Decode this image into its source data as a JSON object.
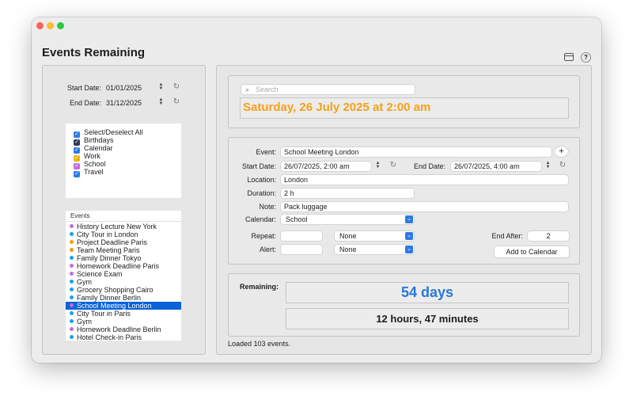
{
  "window": {
    "title": "Events Remaining"
  },
  "dates": {
    "start_label": "Start Date:",
    "start_value": "01/01/2025",
    "end_label": "End Date:",
    "end_value": "31/12/2025"
  },
  "filters": [
    {
      "label": "Select/Deselect All",
      "color": "#2c7be5",
      "checked": true
    },
    {
      "label": "Birthdays",
      "color": "#2d3a5a",
      "checked": true
    },
    {
      "label": "Calendar",
      "color": "#2c7be5",
      "checked": true
    },
    {
      "label": "Work",
      "color": "#e6b800",
      "checked": true
    },
    {
      "label": "School",
      "color": "#c56bd9",
      "checked": true
    },
    {
      "label": "Travel",
      "color": "#2c7be5",
      "checked": true
    }
  ],
  "events": {
    "header": "Events",
    "items": [
      {
        "label": "History Lecture New York",
        "color": "#c56bd9"
      },
      {
        "label": "City Tour in London",
        "color": "#1ea0e6"
      },
      {
        "label": "Project Deadline Paris",
        "color": "#f39c12"
      },
      {
        "label": "Team Meeting Paris",
        "color": "#f39c12"
      },
      {
        "label": "Family Dinner Tokyo",
        "color": "#1ea0e6"
      },
      {
        "label": "Homework Deadline Paris",
        "color": "#c56bd9"
      },
      {
        "label": "Science Exam",
        "color": "#c56bd9"
      },
      {
        "label": "Gym",
        "color": "#1ea0e6"
      },
      {
        "label": "Grocery Shopping Cairo",
        "color": "#1ea0e6"
      },
      {
        "label": "Family Dinner Berlin",
        "color": "#1ea0e6"
      },
      {
        "label": "School Meeting London",
        "color": "#c56bd9",
        "selected": true
      },
      {
        "label": "City Tour in Paris",
        "color": "#1ea0e6"
      },
      {
        "label": "Gym",
        "color": "#1ea0e6"
      },
      {
        "label": "Homework Deadline Berlin",
        "color": "#c56bd9"
      },
      {
        "label": "Hotel Check-in Paris",
        "color": "#1ea0e6"
      }
    ]
  },
  "search": {
    "placeholder": "Search"
  },
  "header_date": "Saturday, 26 July 2025 at 2:00 am",
  "form": {
    "event_label": "Event:",
    "event_value": "School Meeting London",
    "start_label": "Start Date:",
    "start_value": "26/07/2025,   2:00 am",
    "end_label": "End Date:",
    "end_value": "26/07/2025,   4:00 am",
    "location_label": "Location:",
    "location_value": "London",
    "duration_label": "Duration:",
    "duration_value": "2 h",
    "note_label": "Note:",
    "note_value": "Pack luggage",
    "calendar_label": "Calendar:",
    "calendar_value": "School",
    "repeat_label": "Repeat:",
    "repeat_value": "None",
    "alert_label": "Alert:",
    "alert_value": "None",
    "end_after_label": "End After:",
    "end_after_value": "2",
    "add_button": "Add to Calendar"
  },
  "remaining": {
    "label": "Remaining:",
    "days": "54 days",
    "time": "12 hours, 47 minutes"
  },
  "status": "Loaded 103 events.",
  "colors": {
    "accent": "#2c7be5",
    "date_orange": "#f5a01a",
    "days_blue": "#2878d6",
    "selection": "#0a63d8"
  }
}
